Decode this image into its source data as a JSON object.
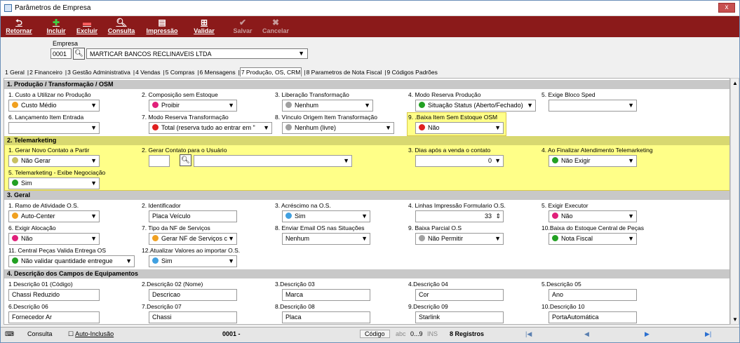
{
  "window": {
    "title": "Parâmetros de Empresa",
    "close_label": "x"
  },
  "toolbar": {
    "retornar": "Retornar",
    "incluir": "Incluir",
    "excluir": "Excluir",
    "consulta": "Consulta",
    "impressao": "Impressão",
    "validar": "Validar",
    "salvar": "Salvar",
    "cancelar": "Cancelar"
  },
  "empresa": {
    "label": "Empresa",
    "code": "0001",
    "name": "MARTICAR BANCOS RECLINAVEIS LTDA"
  },
  "tabs": [
    "1 Geral",
    "2 Financeiro",
    "3 Gestão Administrativa",
    "4 Vendas",
    "5 Compras",
    "6 Mensagens",
    "7 Produção, OS, CRM",
    "8 Parametros de Nota Fiscal",
    "9 Códigos Padrões"
  ],
  "colors": {
    "orange": "#f0a020",
    "pink": "#e0207a",
    "gray": "#a0a0a0",
    "green": "#22a022",
    "red": "#e02020",
    "khaki": "#c8c060",
    "blue": "#40a0e0"
  },
  "sections": {
    "s1": "1. Produção / Transformação / OSM",
    "s2": "2. Telemarketing",
    "s3": "3. Geral",
    "s4": "4. Descrição dos Campos de Equipamentos"
  },
  "s1": {
    "f1": {
      "label": "1. Custo a Utilizar no Produção",
      "value": "Custo Médio"
    },
    "f2": {
      "label": "2. Composição sem Estoque",
      "value": "Proibir"
    },
    "f3": {
      "label": "3. Liberação Transformação",
      "value": "Nenhum"
    },
    "f4": {
      "label": "4. Modo Reserva Produção",
      "value": "Situação Status (Aberto/Fechado)"
    },
    "f5": {
      "label": "5. Exige Bloco Sped",
      "value": ""
    },
    "f6": {
      "label": "6. Lançamento Item Entrada",
      "value": ""
    },
    "f7": {
      "label": "7. Modo Reserva Transformação",
      "value": "Total (reserva tudo ao entrar em \""
    },
    "f8": {
      "label": "8. Vínculo Origem Item Transformação",
      "value": "Nenhum (livre)"
    },
    "f9": {
      "label": "9. .Baixa Item Sem Estoque OSM",
      "value": "Não"
    }
  },
  "s2": {
    "f1": {
      "label": "1. Gerar Novo Contato a Partir",
      "value": "Não Gerar"
    },
    "f2": {
      "label": "2. Gerar Contato para o Usuário",
      "value": ""
    },
    "f3": {
      "label": "3. Dias após a venda o contato",
      "value": "0"
    },
    "f4": {
      "label": "4. Ao Finalizar Atendimento Telemarketing",
      "value": "Não Exigir"
    },
    "f5": {
      "label": "5. Telemarketing - Exibe Negociação",
      "value": "Sim"
    }
  },
  "s3": {
    "f1": {
      "label": "1. Ramo de Atividade O.S.",
      "value": "Auto-Center"
    },
    "f2": {
      "label": "2. Identificador",
      "value": "Placa Veículo"
    },
    "f3": {
      "label": "3. Acréscimo na O.S.",
      "value": "Sim"
    },
    "f4": {
      "label": "4. Linhas Impressão Formulario O.S.",
      "value": "33"
    },
    "f5": {
      "label": "5. Exigir Executor",
      "value": "Não"
    },
    "f6": {
      "label": "6. Exigir Alocação",
      "value": "Não"
    },
    "f7": {
      "label": "7. Tipo da NF de Serviços",
      "value": "Gerar NF de Serviços c"
    },
    "f8": {
      "label": "8. Enviar Email OS nas Situações",
      "value": "Nenhum"
    },
    "f9": {
      "label": "9. Baixa Parcial O.S",
      "value": "Não Permitir"
    },
    "f10": {
      "label": "10.Baixa do Estoque Central de Peças",
      "value": "Nota Fiscal"
    },
    "f11": {
      "label": "11. Central Peças Valida Entrega OS",
      "value": "Não validar quantidade entregue"
    },
    "f12": {
      "label": "12.Atualizar Valores ao importar O.S.",
      "value": "Sim"
    }
  },
  "s4": {
    "d1": {
      "label": "1 Descrição 01 (Código)",
      "value": "Chassi Reduzido"
    },
    "d2": {
      "label": "2.Descrição 02 (Nome)",
      "value": "Descricao"
    },
    "d3": {
      "label": "3.Descrição 03",
      "value": "Marca"
    },
    "d4": {
      "label": "4.Descrição 04",
      "value": "Cor"
    },
    "d5": {
      "label": "5.Descrição 05",
      "value": "Ano"
    },
    "d6": {
      "label": "6.Descrição 06",
      "value": "Fornecedor Ar"
    },
    "d7": {
      "label": "7.Descrição 07",
      "value": "Chassi"
    },
    "d8": {
      "label": "8.Descrição 08",
      "value": "Placa"
    },
    "d9": {
      "label": "9.Descrição 09",
      "value": "Starlink"
    },
    "d10": {
      "label": "10.Descrição 10",
      "value": "PortaAutomática"
    }
  },
  "status": {
    "consulta": "Consulta",
    "auto_inclusao": "Auto-Inclusão",
    "code": "0001 -",
    "codigo": "Código",
    "abc": "abc",
    "nums": "0...9",
    "ins": "INS",
    "registros": "8 Registros"
  }
}
